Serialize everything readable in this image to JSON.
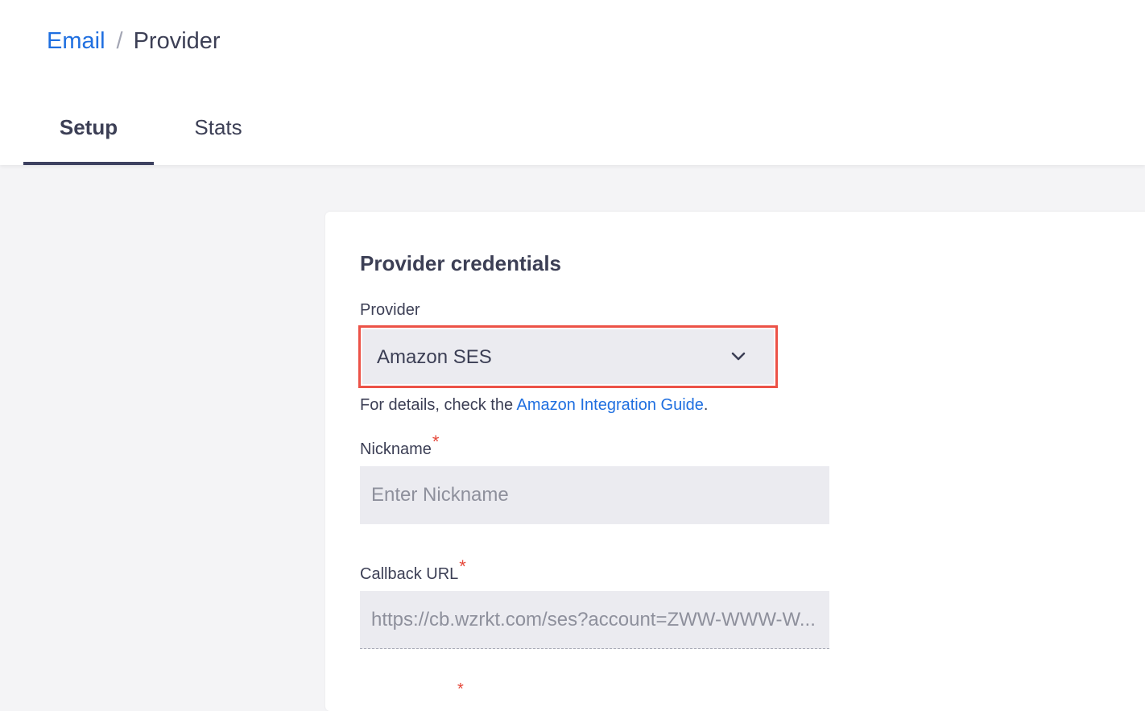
{
  "breadcrumb": {
    "parent": "Email",
    "separator": "/",
    "current": "Provider"
  },
  "tabs": [
    {
      "label": "Setup",
      "active": true
    },
    {
      "label": "Stats",
      "active": false
    }
  ],
  "card": {
    "title": "Provider credentials",
    "provider": {
      "label": "Provider",
      "selected": "Amazon SES",
      "helper_prefix": "For details, check the ",
      "helper_link": "Amazon Integration Guide",
      "helper_suffix": "."
    },
    "nickname": {
      "label": "Nickname",
      "required": "*",
      "placeholder": "Enter Nickname"
    },
    "callback": {
      "label": "Callback URL",
      "required": "*",
      "value": "https://cb.wzrkt.com/ses?account=ZWW-WWW-W..."
    },
    "next_required": "*"
  },
  "colors": {
    "accent": "#1f6fe0",
    "required": "#e5483a",
    "highlight": "#ec5247",
    "tab_indicator": "#3d4160"
  },
  "icons": {
    "select_arrow": "chevron-down-icon"
  }
}
